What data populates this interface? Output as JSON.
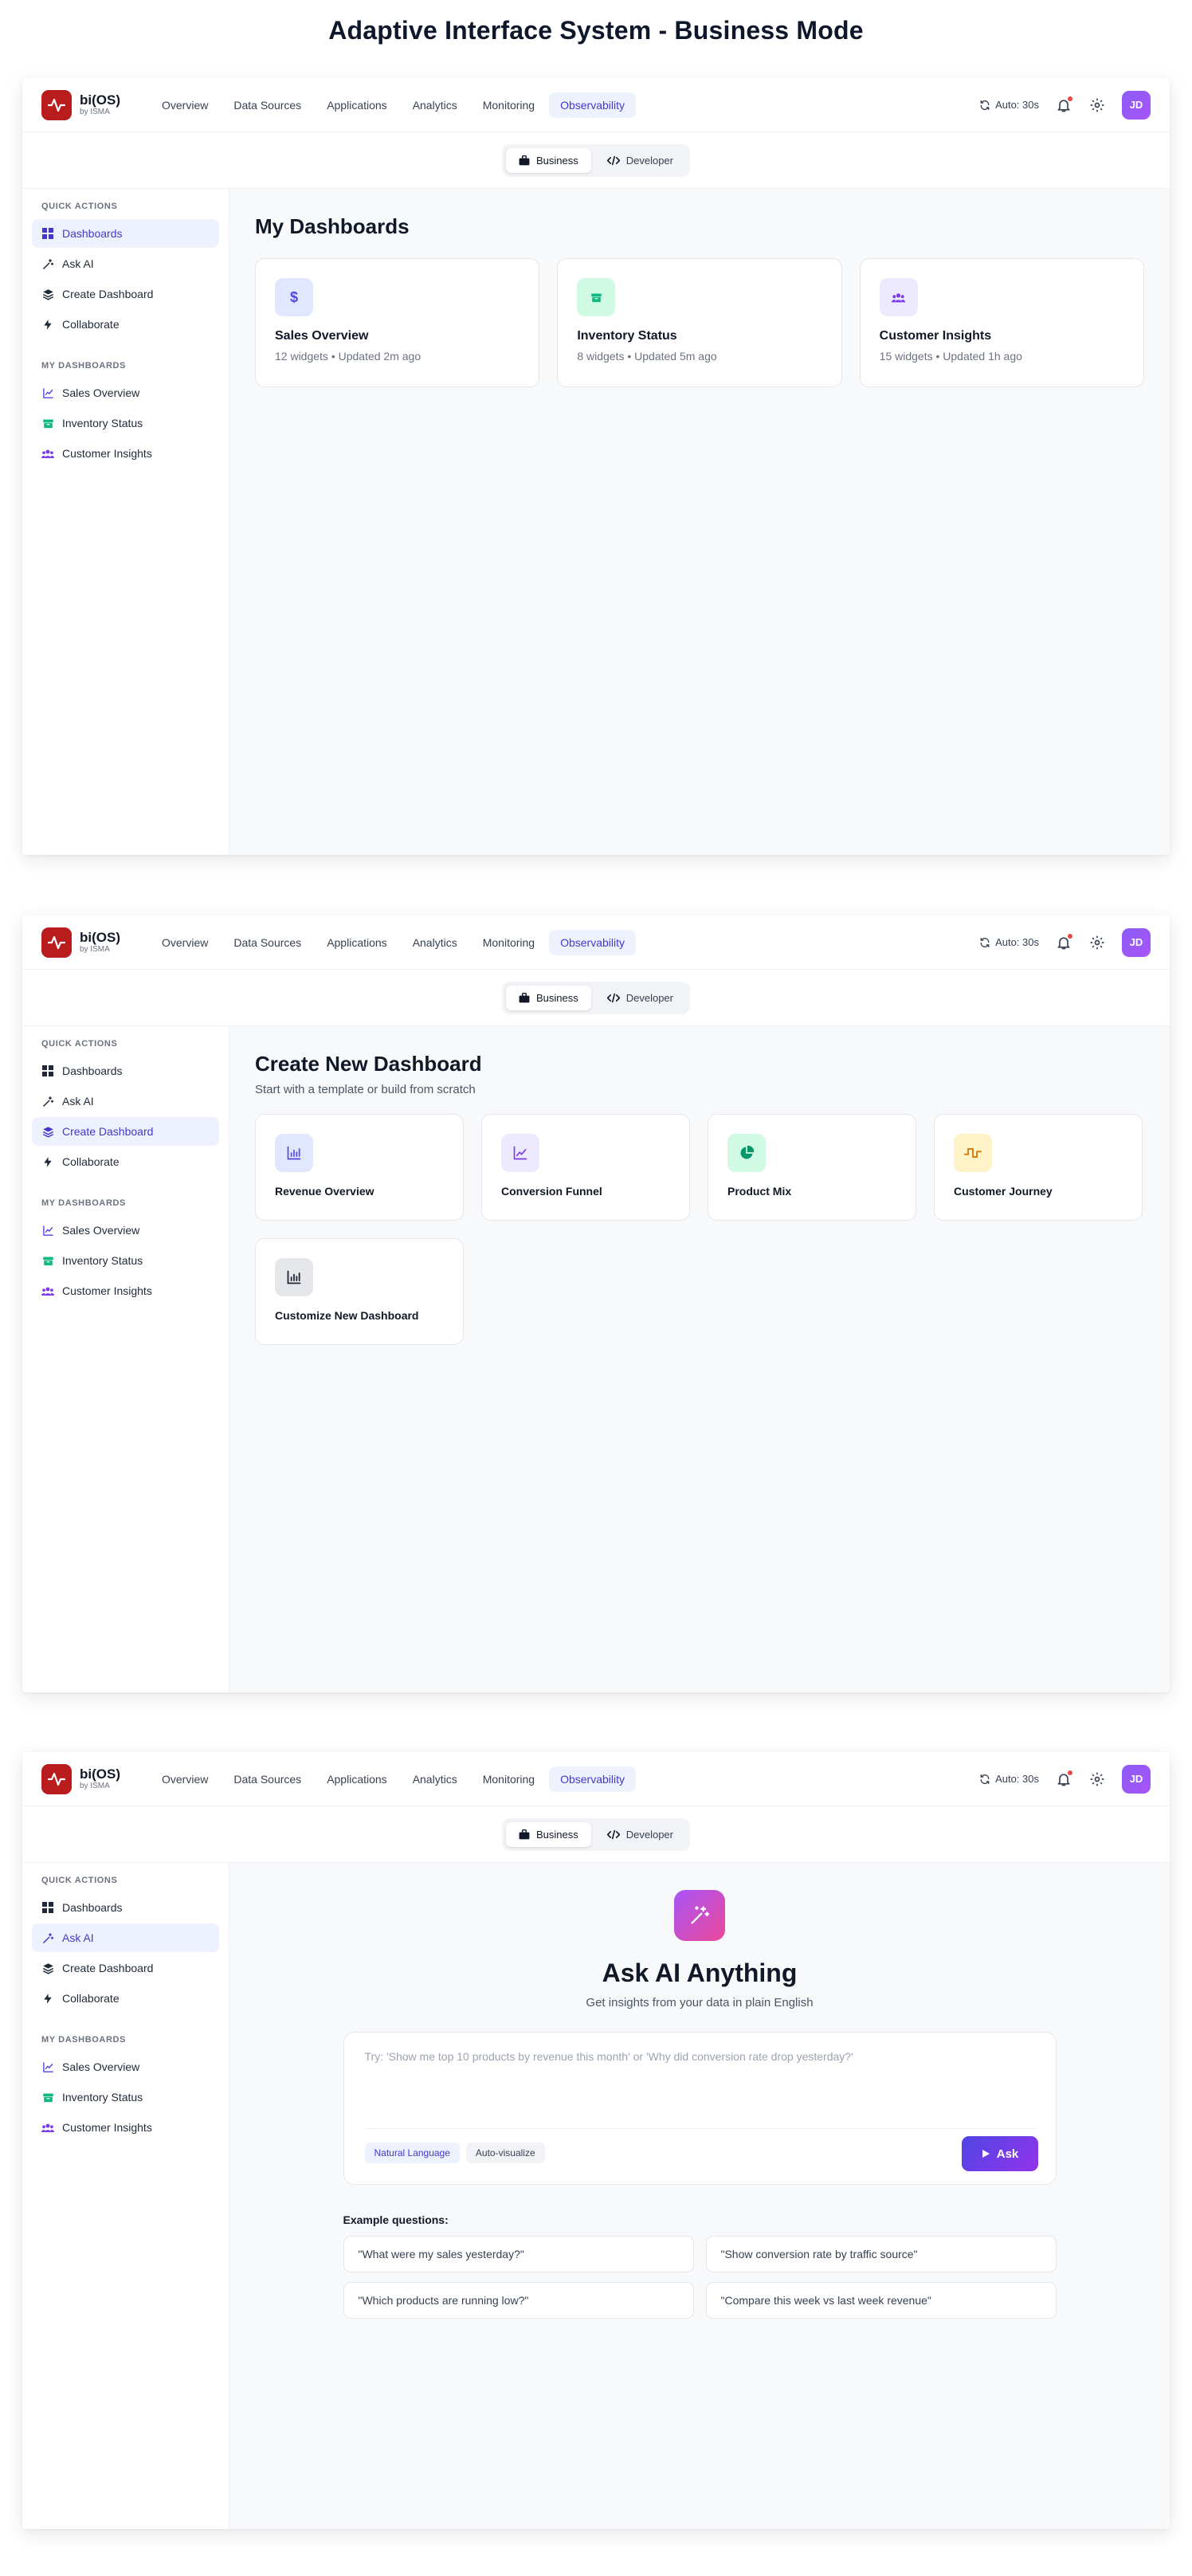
{
  "page_title": "Adaptive Interface System - Business Mode",
  "app": {
    "brand_name": "bi(OS)",
    "brand_sub": "by ISMA",
    "nav": [
      "Overview",
      "Data Sources",
      "Applications",
      "Analytics",
      "Monitoring",
      "Observability"
    ],
    "nav_active": "Observability",
    "auto_refresh": "Auto: 30s",
    "avatar_initials": "JD",
    "modes": [
      "Business",
      "Developer"
    ],
    "mode_active": "Business",
    "sidebar": {
      "quick_actions_label": "QUICK ACTIONS",
      "quick_actions": [
        "Dashboards",
        "Ask AI",
        "Create Dashboard",
        "Collaborate"
      ],
      "my_dashboards_label": "MY DASHBOARDS",
      "my_dashboards": [
        "Sales Overview",
        "Inventory Status",
        "Customer Insights"
      ]
    }
  },
  "screen1": {
    "title": "My Dashboards",
    "cards": [
      {
        "name": "Sales Overview",
        "meta": "12 widgets • Updated 2m ago",
        "icon": "dollar-icon",
        "color": "#4f46e5",
        "bg": "#e0e7ff"
      },
      {
        "name": "Inventory Status",
        "meta": "8 widgets • Updated 5m ago",
        "icon": "box-icon",
        "color": "#10b981",
        "bg": "#d1fae5"
      },
      {
        "name": "Customer Insights",
        "meta": "15 widgets • Updated 1h ago",
        "icon": "users-icon",
        "color": "#7c3aed",
        "bg": "#ede9fe"
      }
    ]
  },
  "screen2": {
    "title": "Create New Dashboard",
    "subtitle": "Start with a template or build from scratch",
    "templates": [
      {
        "name": "Revenue Overview",
        "icon": "bar-chart-icon",
        "color": "#4f46e5",
        "bg": "#e0e7ff"
      },
      {
        "name": "Conversion Funnel",
        "icon": "line-chart-icon",
        "color": "#7c3aed",
        "bg": "#ede9fe"
      },
      {
        "name": "Product Mix",
        "icon": "pie-chart-icon",
        "color": "#059669",
        "bg": "#d1fae5"
      },
      {
        "name": "Customer Journey",
        "icon": "wave-icon",
        "color": "#d97706",
        "bg": "#fef3c7"
      },
      {
        "name": "Customize New Dashboard",
        "icon": "bar-chart-dark-icon",
        "color": "#1f2937",
        "bg": "#e5e7eb"
      }
    ]
  },
  "screen3": {
    "title": "Ask AI Anything",
    "subtitle": "Get insights from your data in plain English",
    "placeholder": "Try: 'Show me top 10 products by revenue this month' or 'Why did conversion rate drop yesterday?'",
    "tags": [
      "Natural Language",
      "Auto-visualize"
    ],
    "ask_label": "Ask",
    "examples_label": "Example questions:",
    "examples": [
      "\"What were my sales yesterday?\"",
      "\"Show conversion rate by traffic source\"",
      "\"Which products are running low?\"",
      "\"Compare this week vs last week revenue\""
    ]
  }
}
